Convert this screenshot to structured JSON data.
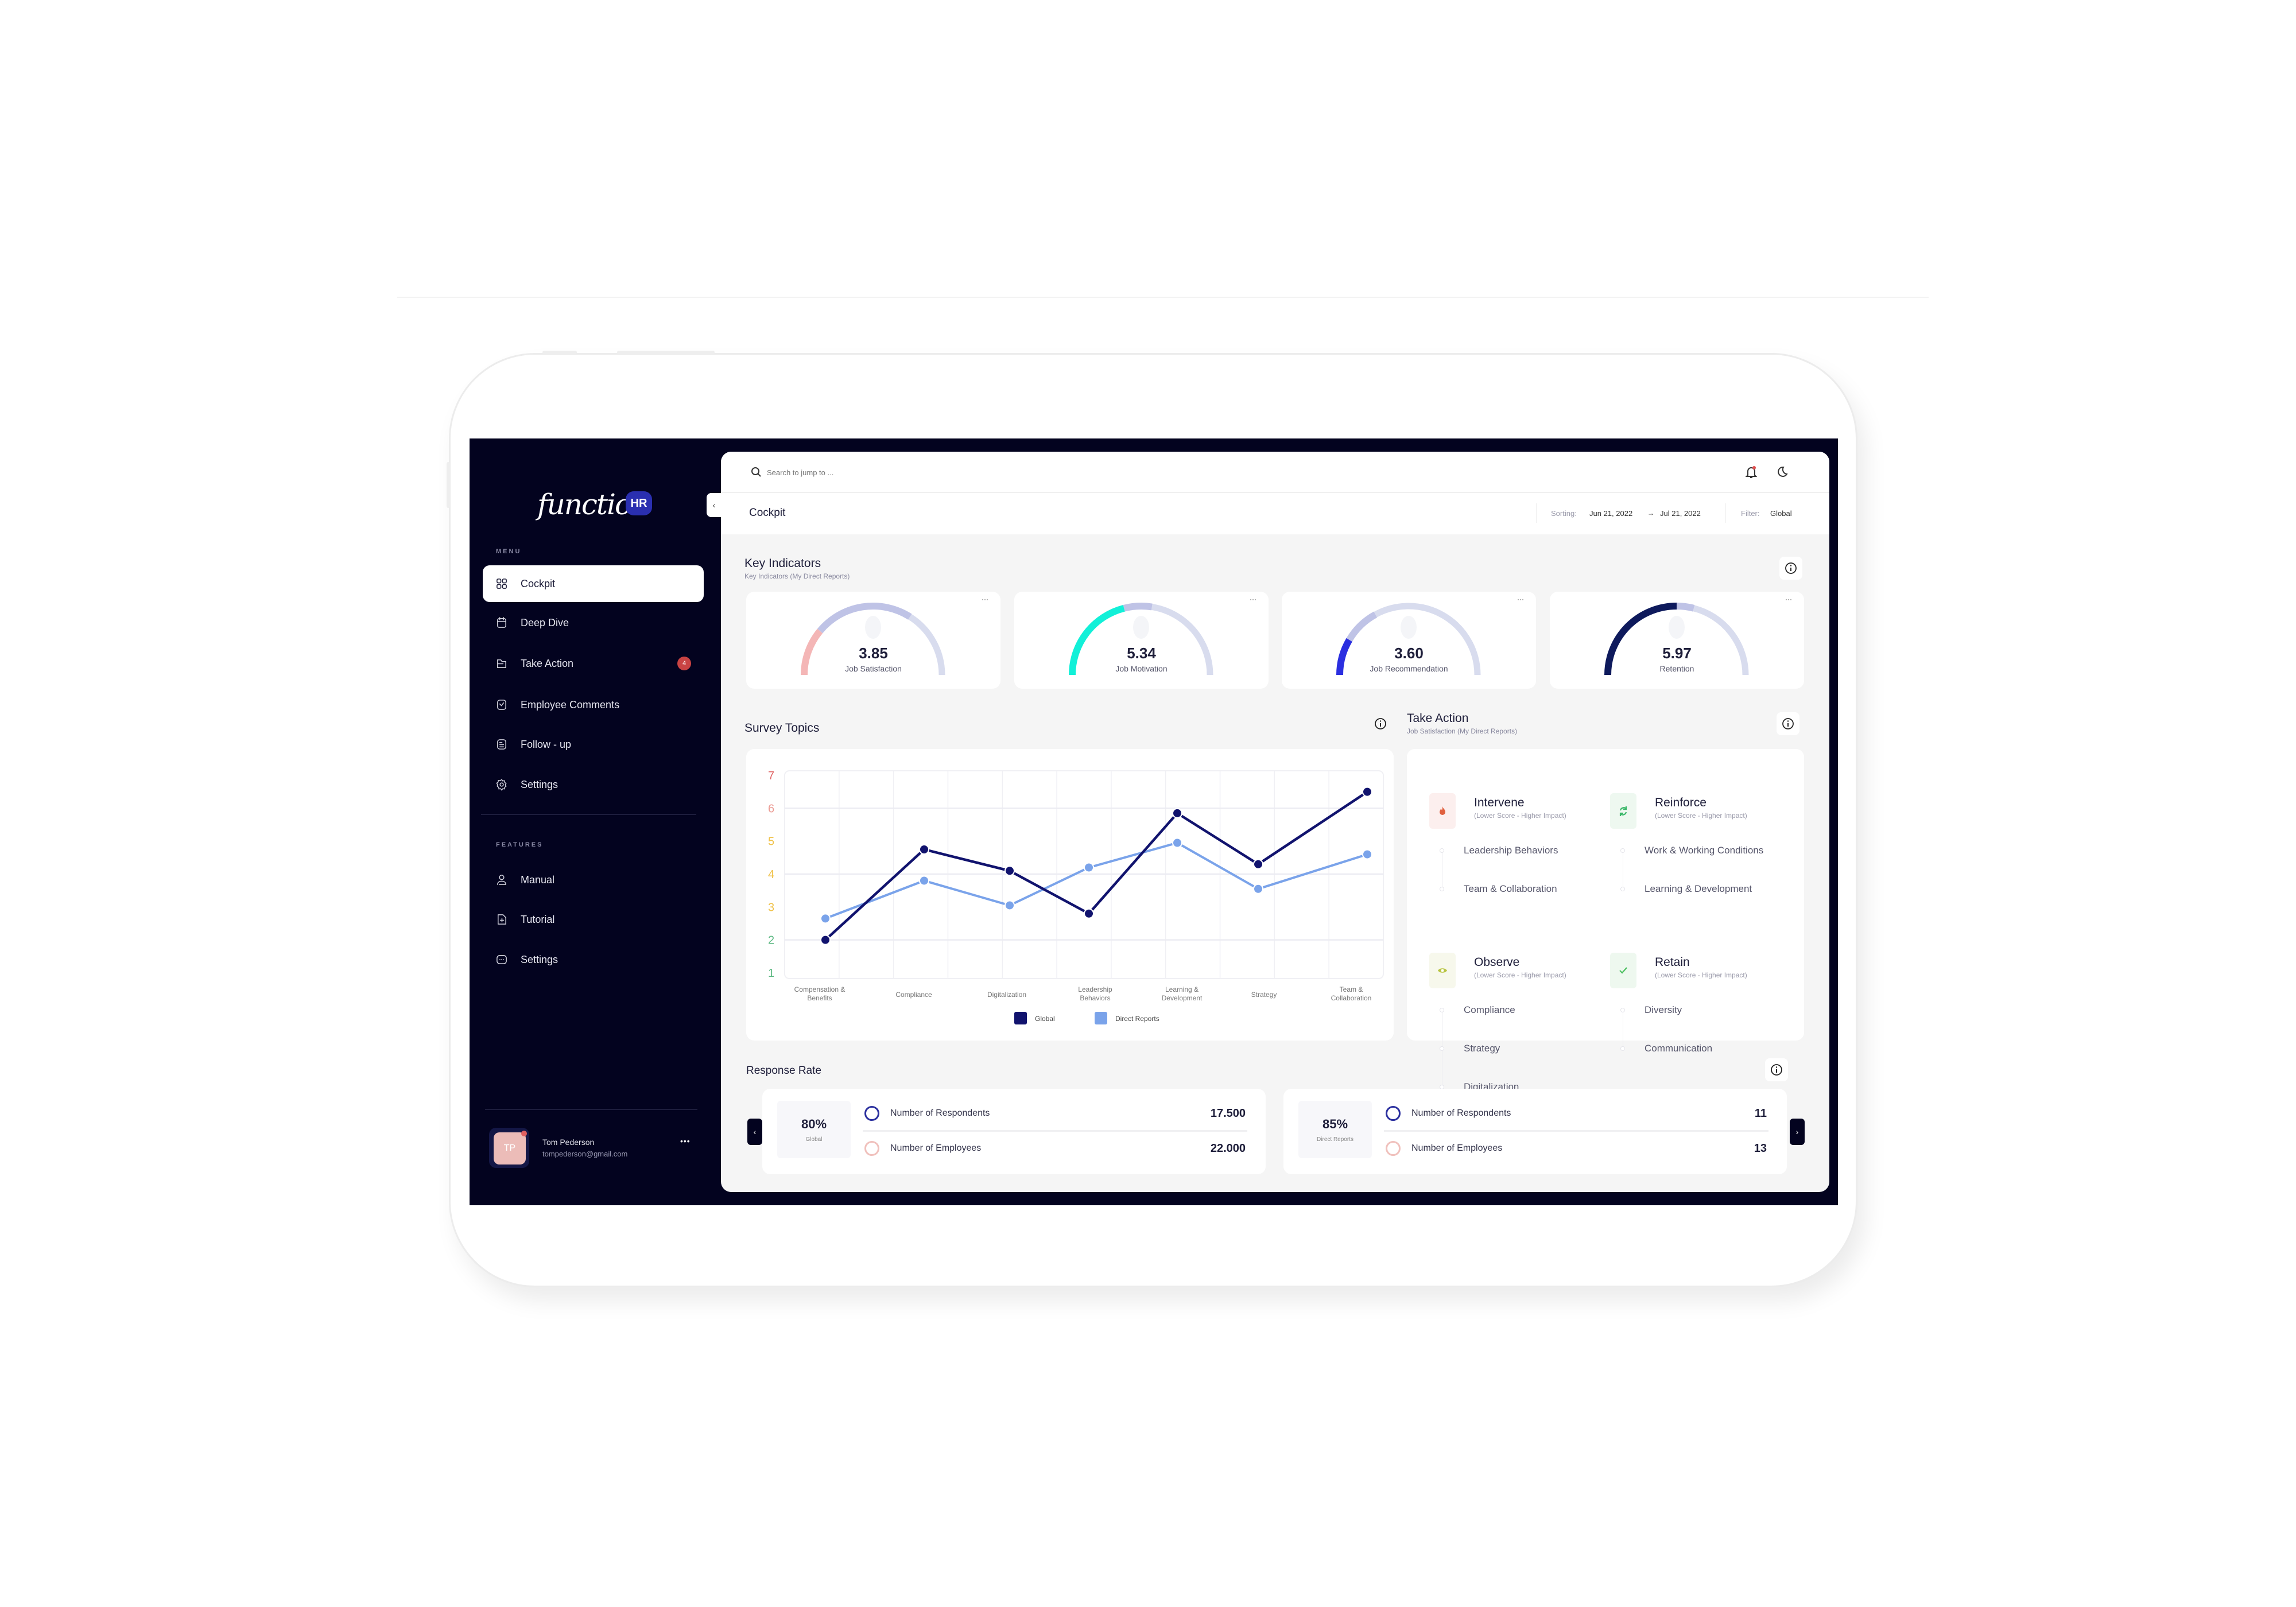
{
  "app": {
    "logo_text": "function",
    "logo_badge": "HR"
  },
  "sidebar": {
    "menu_label": "MENU",
    "menu": [
      {
        "label": "Cockpit",
        "icon": "grid-icon",
        "active": true
      },
      {
        "label": "Deep Dive",
        "icon": "calendar-icon"
      },
      {
        "label": "Take Action",
        "icon": "folder-icon",
        "badge": "4"
      },
      {
        "label": "Employee Comments",
        "icon": "comment-check-icon"
      },
      {
        "label": "Follow - up",
        "icon": "document-icon"
      },
      {
        "label": "Settings",
        "icon": "gear-icon"
      }
    ],
    "features_label": "FEATURES",
    "features": [
      {
        "label": "Manual",
        "icon": "user-icon"
      },
      {
        "label": "Tutorial",
        "icon": "file-plus-icon"
      },
      {
        "label": "Settings",
        "icon": "chat-dots-icon"
      }
    ],
    "user": {
      "initials": "TP",
      "name": "Tom Pederson",
      "email": "tompederson@gmail.com",
      "more": "•••"
    }
  },
  "header": {
    "search_placeholder": "Search to jump to ...",
    "page_title": "Cockpit",
    "sorting_label": "Sorting:",
    "date_from": "Jun 21, 2022",
    "arrow": "→",
    "date_to": "Jul 21, 2022",
    "filter_label": "Filter:",
    "filter_value": "Global"
  },
  "key_indicators": {
    "title": "Key Indicators",
    "subtitle": "Key Indicators (My Direct Reports)",
    "gauges": [
      {
        "value": "3.85",
        "label": "Job Satisfaction",
        "color": "#f4b6b6",
        "fill": 0.22,
        "secondary": 0.68
      },
      {
        "value": "5.34",
        "label": "Job Motivation",
        "color": "#12f0d8",
        "fill": 0.42,
        "secondary": 0.55
      },
      {
        "value": "3.60",
        "label": "Job Recommendation",
        "color": "#2b2fe0",
        "fill": 0.17,
        "secondary": 0.34
      },
      {
        "value": "5.97",
        "label": "Retention",
        "color": "#0e1a5c",
        "fill": 0.5,
        "secondary": 0.58
      }
    ]
  },
  "survey_topics": {
    "title": "Survey Topics"
  },
  "chart_data": {
    "type": "line",
    "categories": [
      [
        "Compensation &",
        "Benefits"
      ],
      [
        "Compliance"
      ],
      [
        "Digitalization"
      ],
      [
        "Leadership",
        "Behaviors"
      ],
      [
        "Learning &",
        "Development"
      ],
      [
        "Strategy"
      ],
      [
        "Team &",
        "Collaboration"
      ]
    ],
    "ylim": [
      1,
      7
    ],
    "yticks": [
      7,
      6,
      5,
      4,
      3,
      2,
      1
    ],
    "ytick_colors": [
      "#e06666",
      "#eb9a92",
      "#f0c24a",
      "#f0c24a",
      "#f0c24a",
      "#5cb882",
      "#5cb882"
    ],
    "grid": true,
    "legend_position": "bottom",
    "series": [
      {
        "name": "Global",
        "color": "#11136e",
        "values": [
          2.0,
          4.75,
          4.1,
          2.8,
          5.85,
          4.3,
          6.5
        ]
      },
      {
        "name": "Direct Reports",
        "color": "#7aa3ea",
        "values": [
          2.65,
          3.8,
          3.05,
          4.2,
          4.95,
          3.55,
          4.6
        ]
      }
    ]
  },
  "take_action": {
    "title": "Take Action",
    "subtitle": "Job Satisfaction (My Direct Reports)",
    "groups": [
      {
        "title": "Intervene",
        "sub": "(Lower Score - Higher Impact)",
        "icon": "flame-icon",
        "color": "#e0603e",
        "bg": "#fcefee",
        "items": [
          "Leadership Behaviors",
          "Team & Collaboration"
        ]
      },
      {
        "title": "Reinforce",
        "sub": "(Lower Score - Higher Impact)",
        "icon": "refresh-icon",
        "color": "#3cb86a",
        "bg": "#eef8f0",
        "items": [
          "Work & Working Conditions",
          "Learning & Development"
        ]
      },
      {
        "title": "Observe",
        "sub": "(Lower Score - Higher Impact)",
        "icon": "eye-icon",
        "color": "#b8c440",
        "bg": "#f7f8ec",
        "items": [
          "Compliance",
          "Strategy",
          "Digitalization"
        ]
      },
      {
        "title": "Retain",
        "sub": "(Lower Score - Higher Impact)",
        "icon": "check-icon",
        "color": "#4cc060",
        "bg": "#eef8ef",
        "items": [
          "Diversity",
          "Communication"
        ]
      }
    ]
  },
  "response_rate": {
    "title": "Response Rate",
    "cards": [
      {
        "pct": "80%",
        "scope": "Global",
        "rows": [
          {
            "label": "Number of Respondents",
            "value": "17.500",
            "ring": "#2a2f9e"
          },
          {
            "label": "Number of Employees",
            "value": "22.000",
            "ring": "#f0c0bc"
          }
        ]
      },
      {
        "pct": "85%",
        "scope": "Direct Reports",
        "rows": [
          {
            "label": "Number of Respondents",
            "value": "11",
            "ring": "#2a2f9e"
          },
          {
            "label": "Number of Employees",
            "value": "13",
            "ring": "#f0c0bc"
          }
        ]
      }
    ],
    "prev": "‹",
    "next": "›"
  }
}
